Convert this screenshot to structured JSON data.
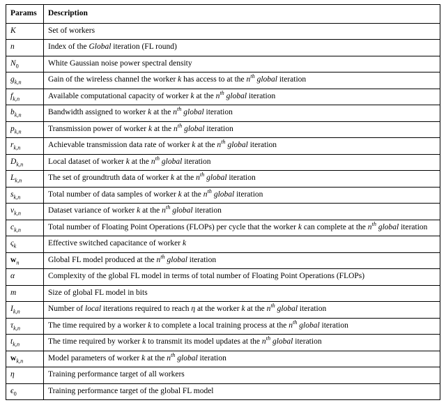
{
  "headers": {
    "params": "Params",
    "description": "Description"
  },
  "rows": [
    {
      "param_html": "<span class='cal'>K</span>",
      "desc_html": "Set of workers"
    },
    {
      "param_html": "<span class='it'>n</span>",
      "desc_html": "Index of the <span class='it'>Global</span> iteration (FL round)"
    },
    {
      "param_html": "<span class='it'>N</span><sub>0</sub>",
      "desc_html": "White Gaussian noise power spectral density"
    },
    {
      "param_html": "<span class='it'>g</span><sub><span class='it'>k</span>,<span class='it'>n</span></sub>",
      "desc_html": "Gain of the wireless channel the worker <span class='it'>k</span> has access to at the <span class='it'>n</span><sup><span class='it'>th</span></sup> <span class='it'>global</span> iteration"
    },
    {
      "param_html": "<span class='it'>f</span><sub><span class='it'>k</span>,<span class='it'>n</span></sub>",
      "desc_html": "Available computational capacity of worker <span class='it'>k</span> at the <span class='it'>n</span><sup><span class='it'>th</span></sup> <span class='it'>global</span> iteration"
    },
    {
      "param_html": "<span class='it'>b</span><sub><span class='it'>k</span>,<span class='it'>n</span></sub>",
      "desc_html": "Bandwidth assigned to worker <span class='it'>k</span> at the <span class='it'>n</span><sup><span class='it'>th</span></sup> <span class='it'>global</span> iteration"
    },
    {
      "param_html": "<span class='it'>p</span><sub><span class='it'>k</span>,<span class='it'>n</span></sub>",
      "desc_html": "Transmission power of worker <span class='it'>k</span> at the <span class='it'>n</span><sup><span class='it'>th</span></sup> <span class='it'>global</span> iteration"
    },
    {
      "param_html": "<span class='it'>r</span><sub><span class='it'>k</span>,<span class='it'>n</span></sub>",
      "desc_html": "Achievable transmission data rate of worker <span class='it'>k</span> at the <span class='it'>n</span><sup><span class='it'>th</span></sup> <span class='it'>global</span> iteration"
    },
    {
      "param_html": "<span class='cal'>D</span><sub><span class='it'>k</span>,<span class='it'>n</span></sub>",
      "desc_html": "Local dataset of worker <span class='it'>k</span> at the <span class='it'>n</span><sup><span class='it'>th</span></sup> <span class='it'>global</span> iteration"
    },
    {
      "param_html": "<span class='cal'>L</span><sub><span class='it'>k</span>,<span class='it'>n</span></sub>",
      "desc_html": "The set of groundtruth data of worker <span class='it'>k</span> at the <span class='it'>n</span><sup><span class='it'>th</span></sup> <span class='it'>global</span> iteration"
    },
    {
      "param_html": "<span class='it'>s</span><sub><span class='it'>k</span>,<span class='it'>n</span></sub>",
      "desc_html": "Total number of data samples of worker <span class='it'>k</span> at the <span class='it'>n</span><sup><span class='it'>th</span></sup> <span class='it'>global</span> iteration"
    },
    {
      "param_html": "<span class='it'>v</span><sub><span class='it'>k</span>,<span class='it'>n</span></sub>",
      "desc_html": "Dataset variance of worker <span class='it'>k</span> at the <span class='it'>n</span><sup><span class='it'>th</span></sup> <span class='it'>global</span> iteration"
    },
    {
      "param_html": "<span class='it'>c</span><sub><span class='it'>k</span>,<span class='it'>n</span></sub>",
      "desc_html": "Total number of Floating Point Operations (FLOPs) per cycle that the worker <span class='it'>k</span> can complete at the <span class='it'>n</span><sup><span class='it'>th</span></sup> <span class='it'>global</span> iteration"
    },
    {
      "param_html": "<span class='it'>ς</span><sub><span class='it'>k</span></sub>",
      "desc_html": "Effective switched capacitance of worker <span class='it'>k</span>"
    },
    {
      "param_html": "<span class='bf'>w</span><sub><span class='it'>n</span></sub>",
      "desc_html": "Global FL model produced at the <span class='it'>n</span><sup><span class='it'>th</span></sup> <span class='it'>global</span> iteration"
    },
    {
      "param_html": "<span class='it'>α</span>",
      "desc_html": "Complexity of the global FL model in terms of total number of Floating Point Operations (FLOPs)"
    },
    {
      "param_html": "<span class='it'>m</span>",
      "desc_html": "Size of global FL model in bits"
    },
    {
      "param_html": "<span class='it'>I</span><sub><span class='it'>k</span>,<span class='it'>n</span></sub>",
      "desc_html": "Number of <span class='it'>local</span> iterations required to reach <span class='it'>η</span> at the worker <span class='it'>k</span> at the <span class='it'>n</span><sup><span class='it'>th</span></sup> <span class='it'>global</span> iteration"
    },
    {
      "param_html": "<span class='it'>τ</span><sub><span class='it'>k</span>,<span class='it'>n</span></sub>",
      "desc_html": "The time required by a worker <span class='it'>k</span> to complete a local training process at the <span class='it'>n</span><sup><span class='it'>th</span></sup> <span class='it'>global</span> iteration"
    },
    {
      "param_html": "<span class='it'>t</span><sub><span class='it'>k</span>,<span class='it'>n</span></sub>",
      "desc_html": "The time required by worker <span class='it'>k</span> to transmit its model updates at the <span class='it'>n</span><sup><span class='it'>th</span></sup> <span class='it'>global</span> iteration"
    },
    {
      "param_html": "<span class='bf'>w</span><sub><span class='it'>k</span>,<span class='it'>n</span></sub>",
      "desc_html": "Model parameters of worker <span class='it'>k</span> at the <span class='it'>n</span><sup><span class='it'>th</span></sup> <span class='it'>global</span> iteration"
    },
    {
      "param_html": "<span class='it'>η</span>",
      "desc_html": "Training performance target of all workers"
    },
    {
      "param_html": "<span class='it'>ϵ</span><sub>0</sub>",
      "desc_html": "Training performance target of the global FL model"
    }
  ]
}
